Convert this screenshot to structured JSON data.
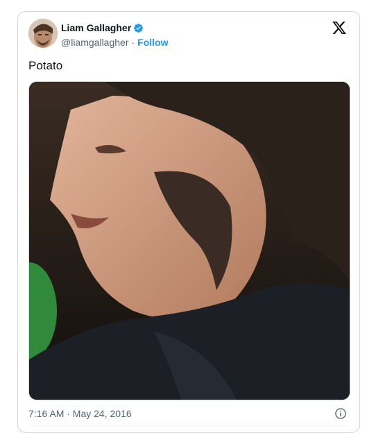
{
  "tweet": {
    "author_name": "Liam Gallagher",
    "handle": "@liamgallagher",
    "separator": "·",
    "follow_label": "Follow",
    "text": "Potato",
    "timestamp": "7:16 AM · May 24, 2016"
  },
  "icons": {
    "verified": "verified-badge-icon",
    "logo": "x-logo-icon",
    "info": "info-icon"
  },
  "colors": {
    "accent": "#1d9bf0",
    "secondary_text": "#536471",
    "border": "#cfd9de"
  }
}
